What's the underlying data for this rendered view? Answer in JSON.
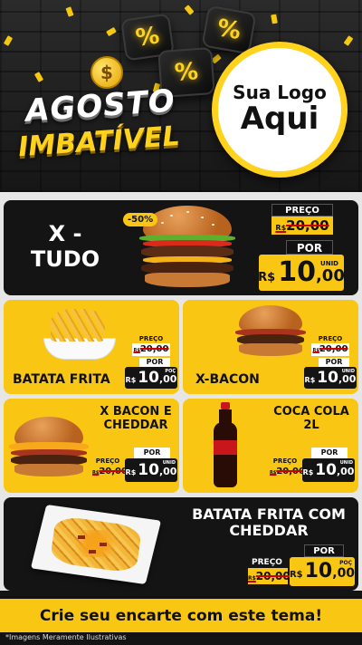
{
  "header": {
    "coin_symbol": "$",
    "title_line1": "AGOSTO",
    "title_line2": "IMBATÍVEL",
    "percent_symbol": "%",
    "logo_line1": "Sua Logo",
    "logo_line2": "Aqui"
  },
  "colors": {
    "accent_yellow": "#f9c713",
    "dark": "#141414",
    "price_box": "#f9c713",
    "strike": "#cc0000"
  },
  "featured": {
    "name_line1": "X -",
    "name_line2": "TUDO",
    "discount_badge": "-50%",
    "price_label": "PREÇO",
    "old_prefix": "R$",
    "old_price": "20,00",
    "por_label": "POR",
    "currency": "R$",
    "price_int": "10",
    "price_dec": ",00",
    "unit": "UNID"
  },
  "items": [
    {
      "name": "BATATA FRITA",
      "price_label": "PREÇO",
      "old_prefix": "R$",
      "old_price": "20,00",
      "por_label": "POR",
      "currency": "R$",
      "price_int": "10",
      "price_dec": ",00",
      "unit": "POÇ"
    },
    {
      "name": "X-BACON",
      "price_label": "PREÇO",
      "old_prefix": "R$",
      "old_price": "20,00",
      "por_label": "POR",
      "currency": "R$",
      "price_int": "10",
      "price_dec": ",00",
      "unit": "UNID"
    },
    {
      "name_line1": "X BACON E",
      "name_line2": "CHEDDAR",
      "price_label": "PREÇO",
      "old_prefix": "R$",
      "old_price": "20,00",
      "por_label": "POR",
      "currency": "R$",
      "price_int": "10",
      "price_dec": ",00",
      "unit": "UNID"
    },
    {
      "name_line1": "COCA COLA",
      "name_line2": "2L",
      "price_label": "PREÇO",
      "old_prefix": "R$",
      "old_price": "20,00",
      "por_label": "POR",
      "currency": "R$",
      "price_int": "10",
      "price_dec": ",00",
      "unit": "UNID"
    },
    {
      "name_line1": "BATATA FRITA COM",
      "name_line2": "CHEDDAR",
      "price_label": "PREÇO",
      "old_prefix": "R$",
      "old_price": "20,00",
      "por_label": "POR",
      "currency": "R$",
      "price_int": "10",
      "price_dec": ",00",
      "unit": "POÇ"
    }
  ],
  "footer": {
    "cta": "Crie seu encarte com este tema!",
    "disclaimer": "*Imagens Meramente Ilustrativas"
  },
  "images": {
    "burger": "burger-icon",
    "fries": "fries-icon",
    "bacon_burger": "bacon-burger-icon",
    "cheddar_burger": "cheddar-burger-icon",
    "soda_bottle": "soda-bottle-icon",
    "cheddar_fries": "cheddar-fries-icon"
  }
}
